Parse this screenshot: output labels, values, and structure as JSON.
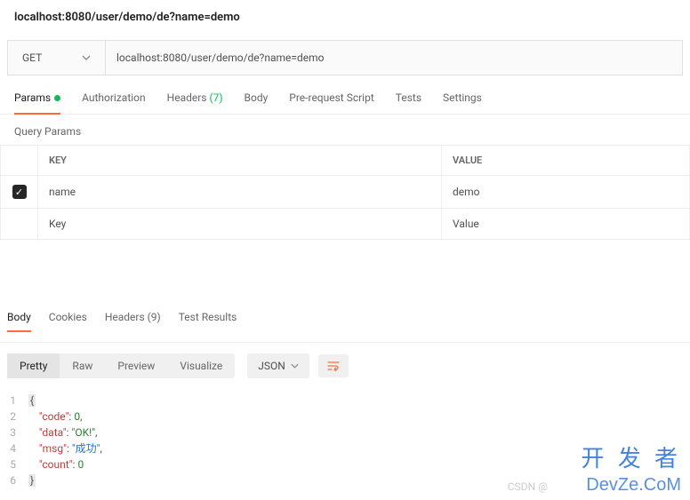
{
  "request": {
    "display_url": "localhost:8080/user/demo/de?name=demo",
    "method": "GET",
    "url": "localhost:8080/user/demo/de?name=demo"
  },
  "tabs": {
    "params": "Params",
    "auth": "Authorization",
    "headers": "Headers",
    "headers_count": "(7)",
    "body": "Body",
    "prereq": "Pre-request Script",
    "tests": "Tests",
    "settings": "Settings"
  },
  "query_params": {
    "title": "Query Params",
    "key_header": "KEY",
    "value_header": "VALUE",
    "rows": [
      {
        "key": "name",
        "value": "demo"
      }
    ],
    "placeholder_key": "Key",
    "placeholder_value": "Value"
  },
  "response_tabs": {
    "body": "Body",
    "cookies": "Cookies",
    "headers": "Headers",
    "headers_count": "(9)",
    "test_results": "Test Results"
  },
  "body_views": {
    "pretty": "Pretty",
    "raw": "Raw",
    "preview": "Preview",
    "visualize": "Visualize",
    "format": "JSON"
  },
  "response_json": {
    "l1": "{",
    "l2_k": "\"code\"",
    "l2_v": "0",
    "l3_k": "\"data\"",
    "l3_v": "\"OK!\"",
    "l4_k": "\"msg\"",
    "l4_v": "\"成功\"",
    "l5_k": "\"count\"",
    "l5_v": "0",
    "l6": "}"
  },
  "watermark": {
    "cn": "开 发 者",
    "en": "DevZe.CoM",
    "csdn": "CSDN @"
  }
}
